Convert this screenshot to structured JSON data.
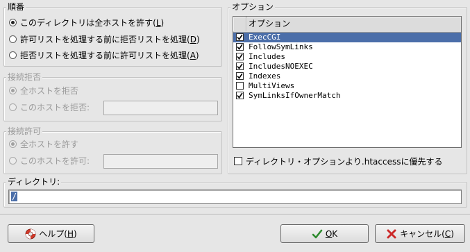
{
  "order": {
    "title": "順番",
    "options": [
      {
        "label": "このディレクトリは全ホストを許す(",
        "key": "L",
        "selected": true
      },
      {
        "label": "許可リストを処理する前に拒否リストを処理(",
        "key": "D",
        "selected": false
      },
      {
        "label": "拒否リストを処理する前に許可リストを処理(",
        "key": "A",
        "selected": false
      }
    ]
  },
  "deny": {
    "title": "接続拒否",
    "all_label": "全ホストを拒否",
    "these_label": "このホストを拒否:",
    "input_value": ""
  },
  "allow": {
    "title": "接続許可",
    "all_label": "全ホストを許す",
    "these_label": "このホストを許可:",
    "input_value": ""
  },
  "options": {
    "title": "オプション",
    "column_header": "オプション",
    "items": [
      {
        "label": "ExecCGI",
        "checked": true,
        "selected": true
      },
      {
        "label": "FollowSymLinks",
        "checked": true,
        "selected": false
      },
      {
        "label": "Includes",
        "checked": true,
        "selected": false
      },
      {
        "label": "IncludesNOEXEC",
        "checked": true,
        "selected": false
      },
      {
        "label": "Indexes",
        "checked": true,
        "selected": false
      },
      {
        "label": "MultiViews",
        "checked": false,
        "selected": false
      },
      {
        "label": "SymLinksIfOwnerMatch",
        "checked": true,
        "selected": false
      }
    ],
    "htaccess_label": "ディレクトリ・オプションより.htaccessに優先する",
    "htaccess_checked": false
  },
  "directory": {
    "title": "ディレクトリ:",
    "value": "/"
  },
  "buttons": {
    "help": {
      "label": "ヘルプ(",
      "key": "H"
    },
    "ok": {
      "label": "",
      "key": "O",
      "suffix": "K"
    },
    "cancel": {
      "label": "キャンセル(",
      "key": "C"
    }
  },
  "colors": {
    "selection": "#4b6ea9",
    "background": "#e6e6e6"
  }
}
